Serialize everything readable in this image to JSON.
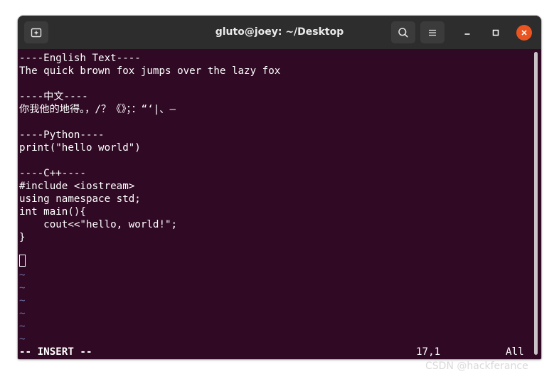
{
  "window": {
    "title": "gluto@joey: ~/Desktop"
  },
  "icons": {
    "new_tab": "new-tab-icon",
    "search": "search-icon",
    "menu": "hamburger-menu-icon",
    "minimize": "minimize-icon",
    "maximize": "maximize-icon",
    "close": "close-icon"
  },
  "colors": {
    "terminal_bg": "#300a24",
    "titlebar_bg": "#2d2d2d",
    "close_button": "#e95420",
    "tilde": "#6d6d9e"
  },
  "editor": {
    "lines": [
      "----English Text----",
      "The quick brown fox jumps over the lazy fox",
      "",
      "----中文----",
      "你我他的地得。，/？《》；：“‘|、—",
      "",
      "----Python----",
      "print(\"hello world\")",
      "",
      "----C++----",
      "#include <iostream>",
      "using namespace std;",
      "int main(){",
      "    cout<<\"hello, world!\";",
      "}",
      ""
    ],
    "empty_markers": [
      "~",
      "~",
      "~",
      "~",
      "~",
      "~"
    ]
  },
  "status": {
    "mode": "-- INSERT --",
    "position": "17,1",
    "scroll": "All"
  },
  "watermark": "CSDN @hackferance"
}
